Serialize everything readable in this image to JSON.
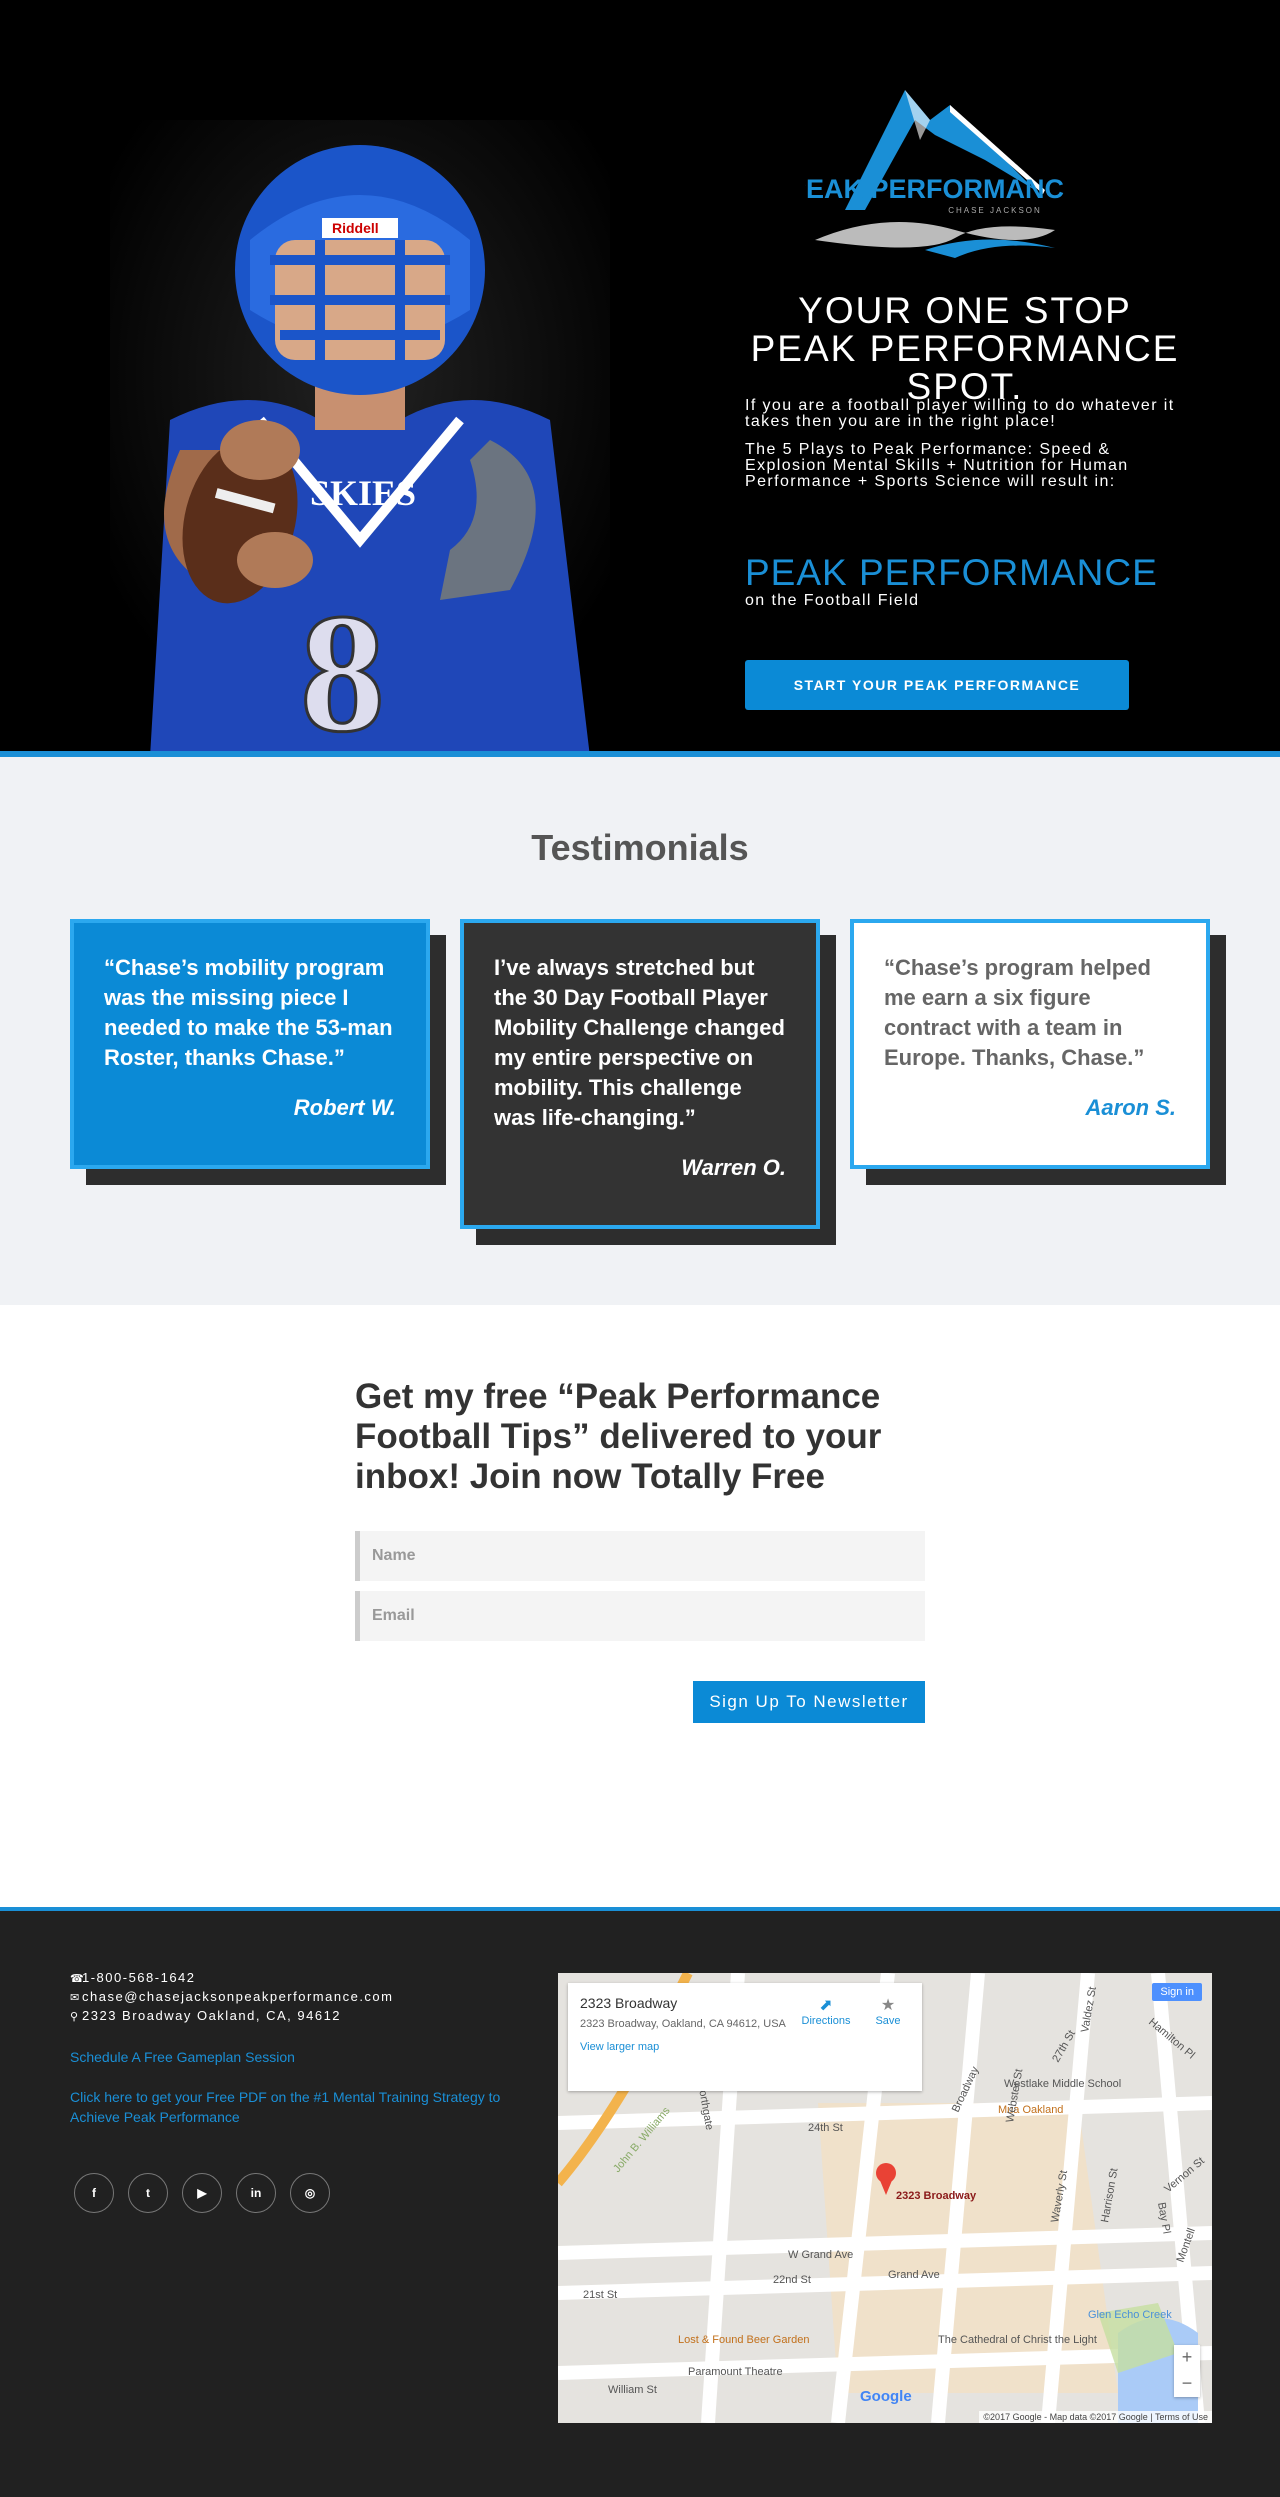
{
  "hero": {
    "logo_title": "PEAK PERFORMANCE",
    "logo_sub": "CHASE JACKSON",
    "heading": "YOUR ONE STOP PEAK PERFORMANCE SPOT.",
    "intro": "If you are a football player willing to do whatever it takes then you are in the right place!",
    "plays": "The 5 Plays to Peak Performance: Speed & Explosion Mental Skills + Nutrition for Human Performance + Sports Science will result in:",
    "peak_big": "PEAK PERFORMANCE",
    "peak_sub": "on the Football Field",
    "cta_label": "START YOUR PEAK PERFORMANCE",
    "jersey_number": "8",
    "jersey_text": "SKIES",
    "helmet_brand": "Riddell",
    "colors": {
      "accent": "#1a8fd6",
      "jersey": "#1f47b8"
    }
  },
  "testimonials": {
    "title": "Testimonials",
    "items": [
      {
        "quote": "“Chase’s mobility program was the missing piece I needed to make the 53-man Roster, thanks Chase.”",
        "author": "Robert W."
      },
      {
        "quote": "I’ve always stretched but the 30 Day Football Player Mobility Challenge changed my entire perspective on mobility. This challenge was life-changing.”",
        "author": "Warren O."
      },
      {
        "quote": "“Chase’s program helped me earn a six figure contract with a team in Europe. Thanks, Chase.”",
        "author": "Aaron S."
      }
    ]
  },
  "newsletter": {
    "title": "Get my free “Peak Performance Football Tips” delivered to your inbox! Join now Totally Free",
    "name_placeholder": "Name",
    "email_placeholder": "Email",
    "button_label": "Sign Up To Newsletter"
  },
  "footer": {
    "phone": "1-800-568-1642",
    "email": "chase@chasejacksonpeakperformance.com",
    "address": "2323 Broadway Oakland, CA, 94612",
    "link_session": "Schedule A Free Gameplan Session",
    "link_pdf": "Click here to get your Free PDF on the #1 Mental Training Strategy to Achieve Peak Performance",
    "social": [
      {
        "icon": "facebook-icon",
        "glyph": "f"
      },
      {
        "icon": "twitter-icon",
        "glyph": "t"
      },
      {
        "icon": "youtube-icon",
        "glyph": "▶"
      },
      {
        "icon": "linkedin-icon",
        "glyph": "in"
      },
      {
        "icon": "instagram-icon",
        "glyph": "◎"
      }
    ],
    "map": {
      "place": "2323 Broadway",
      "place_address": "2323 Broadway, Oakland, CA 94612, USA",
      "view_larger": "View larger map",
      "directions": "Directions",
      "save": "Save",
      "sign_in": "Sign in",
      "marker_label": "2323 Broadway",
      "labels": [
        "Westlake Middle School",
        "Mua Oakland",
        "24th St",
        "John B. Williams",
        "Northgate",
        "Broadway",
        "Webster St",
        "Waverly St",
        "Harrison St",
        "Bay Pl",
        "Vernon St",
        "27th St",
        "Valdez St",
        "Hamilton Pl",
        "W Grand Ave",
        "Grand Ave",
        "22nd St",
        "21st St",
        "William St",
        "Lost & Found Beer Garden",
        "Paramount Theatre",
        "The Cathedral of Christ the Light",
        "Glen Echo Creek",
        "Montell"
      ],
      "attribution": "©2017 Google - Map data ©2017 Google",
      "terms": "Terms of Use",
      "google": "Google"
    }
  }
}
